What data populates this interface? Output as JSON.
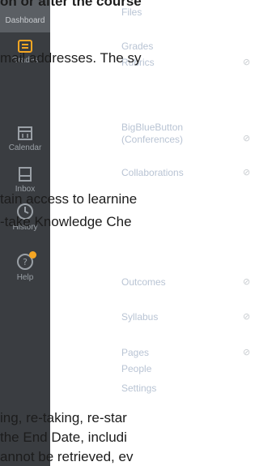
{
  "global_nav": {
    "dashboard": "Dashboard",
    "grades": "Grades",
    "calendar": "Calendar",
    "inbox": "Inbox",
    "history": "History",
    "help": "Help"
  },
  "course_nav": {
    "items": [
      "Files",
      "Grades",
      "Rubrics",
      "BigBlueButton (Conferences)",
      "Collaborations",
      "Outcomes",
      "Syllabus",
      "Pages",
      "People",
      "Settings"
    ]
  },
  "overlay_text": {
    "line0": "on or after the course",
    "line1": "mail addresses. The sy",
    "line2": "tain access to learnine",
    "line3": "-take Knowledge Che",
    "line4": "ing, re-taking, re-star",
    "line5": " the End Date, includi",
    "line6": "annot be retrieved, ev"
  },
  "colors": {
    "nav_bg": "#3a3d41",
    "badge": "#f5a623",
    "link": "#b9c4d4"
  }
}
